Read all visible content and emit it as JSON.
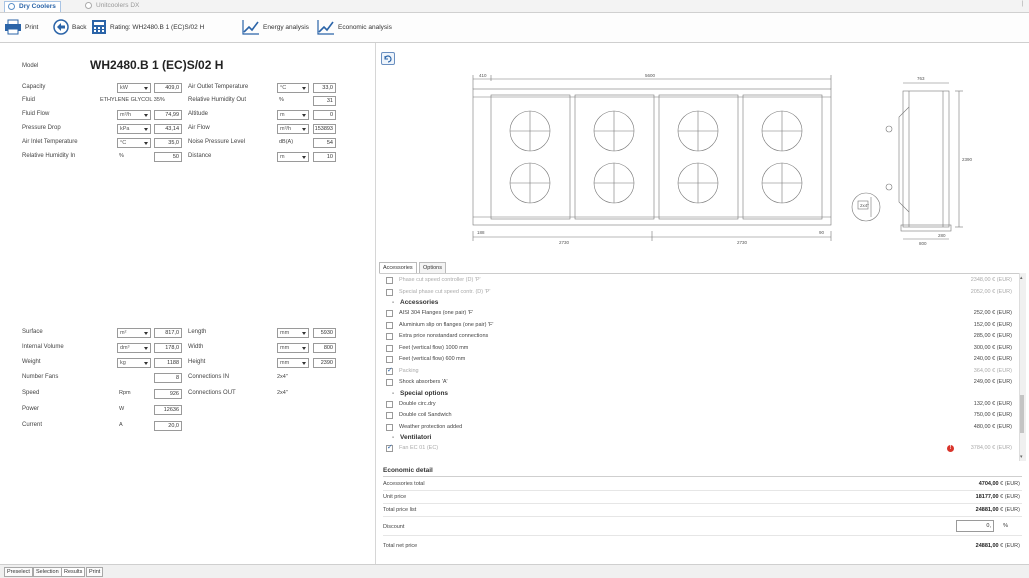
{
  "tabs": [
    {
      "label": "Dry Coolers"
    },
    {
      "label": "Unitcoolers DX"
    }
  ],
  "toolbar": {
    "print": "Print",
    "back": "Back",
    "rating": "Rating: WH2480.B 1 (EC)S/02 H",
    "energy": "Energy analysis",
    "economic": "Economic analysis"
  },
  "left": {
    "model_label": "Model",
    "model_value": "WH2480.B 1 (EC)S/02 H",
    "capacity": {
      "label": "Capacity",
      "unit": "kW",
      "value": "409,0"
    },
    "fluid": {
      "label": "Fluid",
      "value": "ETHYLENE GLYCOL 35%"
    },
    "fluid_flow": {
      "label": "Fluid Flow",
      "unit": "m³/h",
      "value": "74,99"
    },
    "pressure_drop": {
      "label": "Pressure Drop",
      "unit": "kPa",
      "value": "43,14"
    },
    "air_inlet": {
      "label": "Air Inlet Temperature",
      "unit": "°C",
      "value": "35,0"
    },
    "rh_in": {
      "label": "Relative Humidity In",
      "unit": "%",
      "value": "50"
    },
    "air_outlet": {
      "label": "Air Outlet Temperature",
      "unit": "°C",
      "value": "33,0"
    },
    "rh_out": {
      "label": "Relative Humidity Out",
      "unit": "%",
      "value": "31"
    },
    "altitude": {
      "label": "Altitude",
      "unit": "m",
      "value": "0"
    },
    "air_flow": {
      "label": "Air Flow",
      "unit": "m³/h",
      "value": "153893"
    },
    "noise": {
      "label": "Noise Pressure Level",
      "unit": "dB(A)",
      "value": "54"
    },
    "distance": {
      "label": "Distance",
      "unit": "m",
      "value": "10"
    },
    "surface": {
      "label": "Surface",
      "unit": "m²",
      "value": "817,0"
    },
    "internal_volume": {
      "label": "Internal Volume",
      "unit": "dm³",
      "value": "178,0"
    },
    "weight": {
      "label": "Weight",
      "unit": "kg",
      "value": "1188"
    },
    "number_fans": {
      "label": "Number Fans",
      "value": "8"
    },
    "speed": {
      "label": "Speed",
      "unit": "Rpm",
      "value": "926"
    },
    "power": {
      "label": "Power",
      "unit": "W",
      "value": "12636"
    },
    "current": {
      "label": "Current",
      "unit": "A",
      "value": "20,0"
    },
    "length": {
      "label": "Length",
      "unit": "mm",
      "value": "5930"
    },
    "width": {
      "label": "Width",
      "unit": "mm",
      "value": "800"
    },
    "height": {
      "label": "Height",
      "unit": "mm",
      "value": "2390"
    },
    "conn_in": {
      "label": "Connections IN",
      "value": "2x4\""
    },
    "conn_out": {
      "label": "Connections OUT",
      "value": "2x4\""
    }
  },
  "drawing": {
    "dims": [
      "410",
      "5600",
      "2730",
      "2730",
      "763",
      "188",
      "90",
      "2390",
      "800",
      "280",
      "2x4\""
    ]
  },
  "accessories": {
    "tabs": [
      "Accessories",
      "Options"
    ],
    "rows": [
      {
        "kind": "item",
        "name": "Phase cut speed controller (D) 'P'",
        "price": "2348,00 € (EUR)",
        "dim": true,
        "checked": false
      },
      {
        "kind": "item",
        "name": "Special phase cut speed contr. (D) 'P'",
        "price": "2052,00 € (EUR)",
        "dim": true,
        "checked": false
      },
      {
        "kind": "head",
        "name": "Accessories"
      },
      {
        "kind": "item",
        "name": "AISI 304 Flanges (one pair) 'F'",
        "price": "252,00 € (EUR)",
        "dim": false,
        "checked": false
      },
      {
        "kind": "item",
        "name": "Aluminium slip on flanges (one pair) 'F'",
        "price": "152,00 € (EUR)",
        "dim": false,
        "checked": false
      },
      {
        "kind": "item",
        "name": "Extra price nonstandard connections",
        "price": "285,00 € (EUR)",
        "dim": false,
        "checked": false
      },
      {
        "kind": "item",
        "name": "Feet (vertical flow) 1000 mm",
        "price": "300,00 € (EUR)",
        "dim": false,
        "checked": false
      },
      {
        "kind": "item",
        "name": "Feet (vertical flow) 600 mm",
        "price": "240,00 € (EUR)",
        "dim": false,
        "checked": false
      },
      {
        "kind": "item",
        "name": "Packing",
        "price": "364,00 € (EUR)",
        "dim": true,
        "checked": true
      },
      {
        "kind": "item",
        "name": "Shock absorbers 'A'",
        "price": "249,00 € (EUR)",
        "dim": false,
        "checked": false
      },
      {
        "kind": "head",
        "name": "Special options"
      },
      {
        "kind": "item",
        "name": "Double circ.dry",
        "price": "132,00 € (EUR)",
        "dim": false,
        "checked": false
      },
      {
        "kind": "item",
        "name": "Double coil Sandwich",
        "price": "750,00 € (EUR)",
        "dim": false,
        "checked": false
      },
      {
        "kind": "item",
        "name": "Weather protection added",
        "price": "480,00 € (EUR)",
        "dim": false,
        "checked": false
      },
      {
        "kind": "head",
        "name": "Ventilatori"
      },
      {
        "kind": "item",
        "name": "Fan EC 01 (EC)",
        "price": "3784,00 € (EUR)",
        "dim": true,
        "checked": true,
        "alert": true
      }
    ]
  },
  "economic": {
    "title": "Economic detail",
    "accessories_total": {
      "label": "Accessories total",
      "value": "4704,00",
      "currency": "€ (EUR)"
    },
    "unit_price": {
      "label": "Unit price",
      "value": "18177,00",
      "currency": "€ (EUR)"
    },
    "total_price_list": {
      "label": "Total price list",
      "value": "24881,00",
      "currency": "€ (EUR)"
    },
    "discount": {
      "label": "Discount",
      "value": "0,",
      "unit": "%"
    },
    "total_net_price": {
      "label": "Total net price",
      "value": "24881,00",
      "currency": "€ (EUR)"
    }
  },
  "bottom_tabs": [
    "Preselect",
    "Selection",
    "Results",
    "Print"
  ],
  "colors": {
    "accent": "#2b64a8",
    "alert": "#d9342b"
  }
}
